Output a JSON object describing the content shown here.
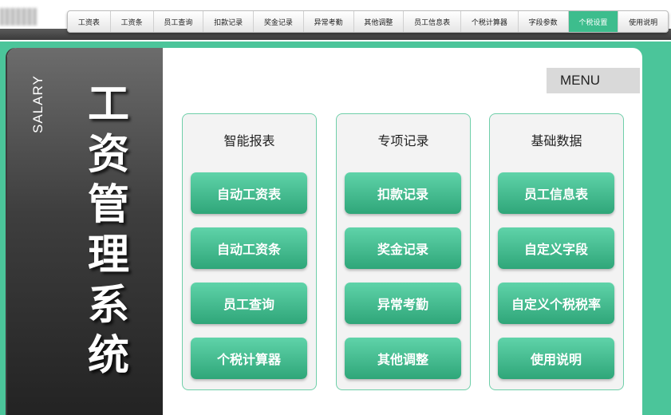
{
  "tabs": [
    "工资表",
    "工资条",
    "员工查询",
    "扣款记录",
    "奖金记录",
    "异常考勤",
    "其他调整",
    "员工信息表",
    "个税计算器",
    "字段参数",
    "个税设置",
    "使用说明"
  ],
  "active_tab": "个税设置",
  "sidebar": {
    "vertical_label": "SALARY",
    "title_chars": [
      "工",
      "资",
      "管",
      "理",
      "系",
      "统"
    ]
  },
  "menu_label": "MENU",
  "columns": [
    {
      "title": "智能报表",
      "buttons": [
        "自动工资表",
        "自动工资条",
        "员工查询",
        "个税计算器"
      ]
    },
    {
      "title": "专项记录",
      "buttons": [
        "扣款记录",
        "奖金记录",
        "异常考勤",
        "其他调整"
      ]
    },
    {
      "title": "基础数据",
      "buttons": [
        "员工信息表",
        "自定义字段",
        "自定义个税税率",
        "使用说明"
      ]
    }
  ],
  "colors": {
    "accent": "#3dbd8d",
    "background": "#4bc59a",
    "sidebar_dark": "#232323"
  }
}
